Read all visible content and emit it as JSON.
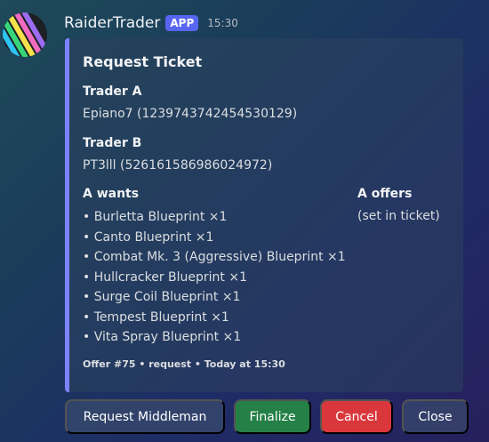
{
  "message": {
    "author": "RaiderTrader",
    "badge": "APP",
    "timestamp": "15:30"
  },
  "embed": {
    "title": "Request Ticket",
    "accent_color": "#7c82ff",
    "trader_a": {
      "name": "Trader A",
      "value": "Epiano7 (1239743742454530129)"
    },
    "trader_b": {
      "name": "Trader B",
      "value": "PT3lll (526161586986024972)"
    },
    "wants": {
      "name": "A wants",
      "items": [
        "• Burletta Blueprint ×1",
        "• Canto Blueprint ×1",
        "• Combat Mk. 3 (Aggressive) Blueprint ×1",
        "• Hullcracker Blueprint ×1",
        "• Surge Coil Blueprint ×1",
        "• Tempest Blueprint ×1",
        "• Vita Spray Blueprint ×1"
      ]
    },
    "offers": {
      "name": "A offers",
      "value": "(set in ticket)"
    },
    "footer": "Offer #75 • request  •  Today at 15:30"
  },
  "buttons": {
    "request_middleman": "Request Middleman",
    "finalize": "Finalize",
    "cancel": "Cancel",
    "close": "Close"
  },
  "colors": {
    "brand_badge": "#5865f2",
    "success": "#248046",
    "danger": "#da373c"
  }
}
